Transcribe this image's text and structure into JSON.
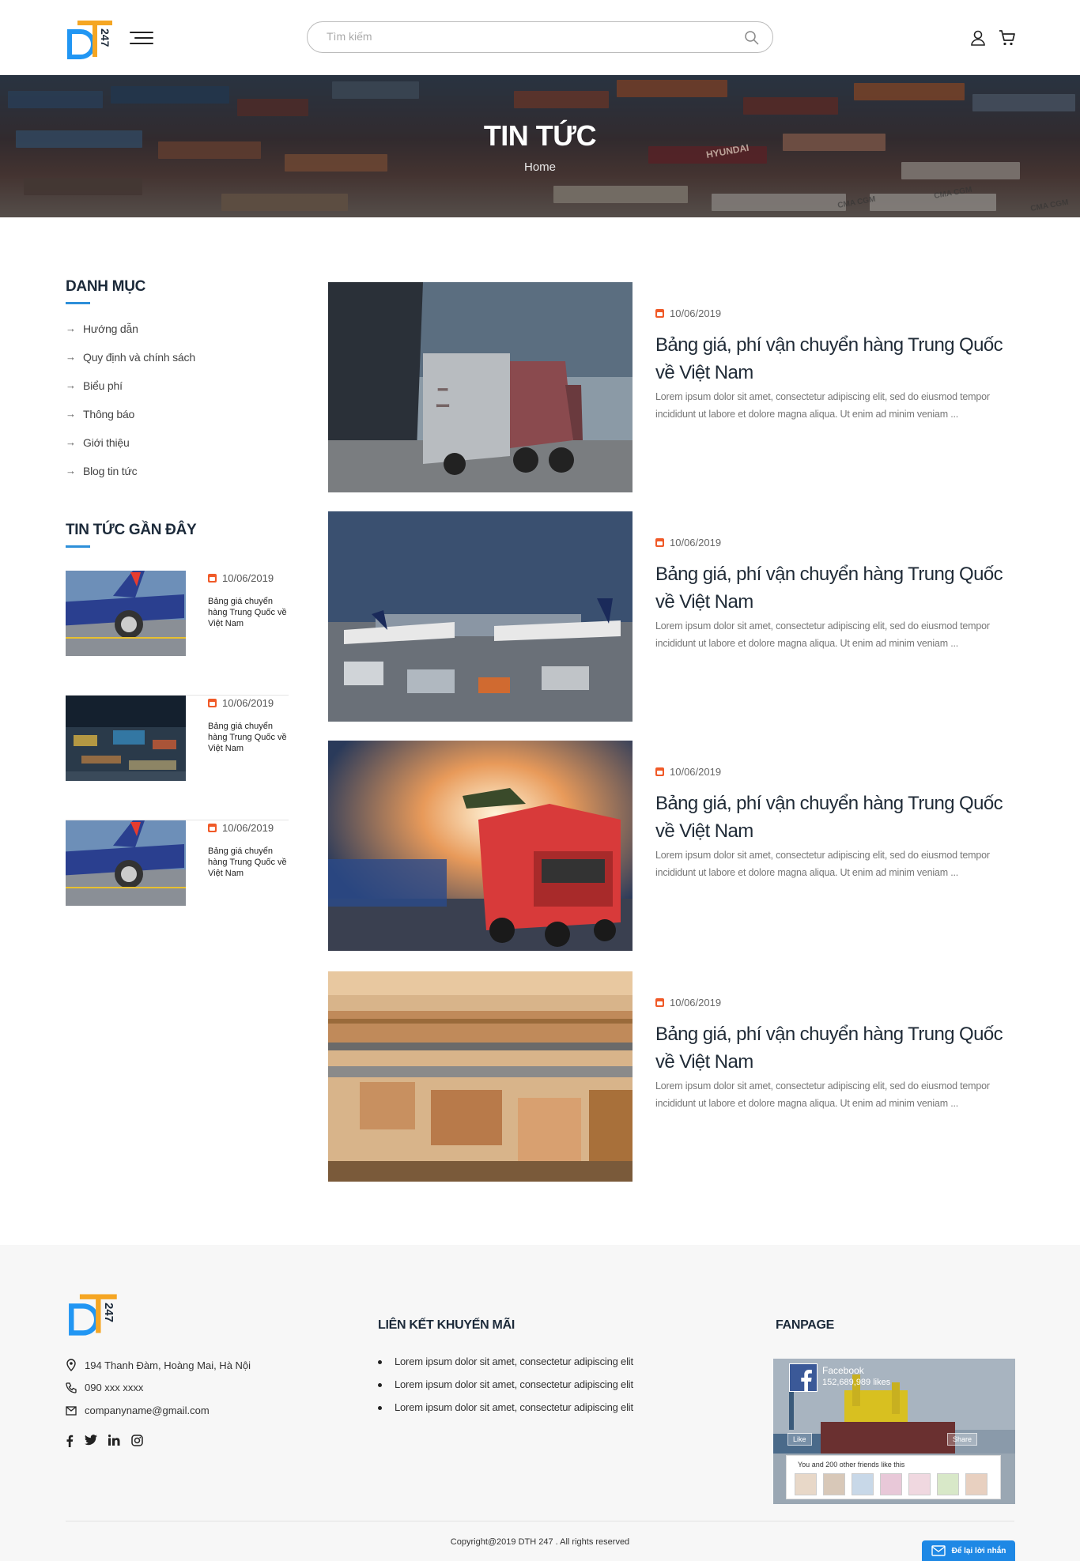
{
  "header": {
    "search_placeholder": "Tìm kiếm",
    "logo_text": "247"
  },
  "banner": {
    "title": "TIN TỨC",
    "breadcrumb": "Home",
    "container_texts": [
      "HYUNDAI",
      "CMA CGM",
      "CMA CGM",
      "CMA CGM"
    ]
  },
  "sidebar": {
    "categories_title": "DANH MỤC",
    "categories": [
      {
        "label": "Hướng dẫn"
      },
      {
        "label": "Quy định và chính sách"
      },
      {
        "label": "Biểu phí"
      },
      {
        "label": "Thông báo"
      },
      {
        "label": "Giới thiệu"
      },
      {
        "label": "Blog tin tức"
      }
    ],
    "recent_title": "TIN TỨC GẦN ĐÂY",
    "recent": [
      {
        "date": "10/06/2019",
        "title": "Bảng giá chuyển hàng Trung Quốc về Việt Nam",
        "image": "airplane"
      },
      {
        "date": "10/06/2019",
        "title": "Bảng giá chuyển hàng Trung Quốc về Việt Nam",
        "image": "port-night"
      },
      {
        "date": "10/06/2019",
        "title": "Bảng giá chuyển hàng Trung Quốc về Việt Nam",
        "image": "airplane"
      }
    ]
  },
  "posts": [
    {
      "date": "10/06/2019",
      "title": "Bảng giá, phí vận chuyển hàng Trung Quốc về Việt Nam",
      "excerpt": "Lorem ipsum dolor sit amet, consectetur adipiscing elit, sed do eiusmod tempor incididunt ut labore et dolore magna aliqua. Ut enim ad minim veniam ...",
      "image": "truck"
    },
    {
      "date": "10/06/2019",
      "title": "Bảng giá, phí vận chuyển hàng Trung Quốc về Việt Nam",
      "excerpt": "Lorem ipsum dolor sit amet, consectetur adipiscing elit, sed do eiusmod tempor incididunt ut labore et dolore magna aliqua. Ut enim ad minim veniam ...",
      "image": "airport"
    },
    {
      "date": "10/06/2019",
      "title": "Bảng giá, phí vận chuyển hàng Trung Quốc về Việt Nam",
      "excerpt": "Lorem ipsum dolor sit amet, consectetur adipiscing elit, sed do eiusmod tempor incididunt ut labore et dolore magna aliqua. Ut enim ad minim veniam ...",
      "image": "red-truck"
    },
    {
      "date": "10/06/2019",
      "title": "Bảng giá, phí vận chuyển hàng Trung Quốc về Việt Nam",
      "excerpt": "Lorem ipsum dolor sit amet, consectetur adipiscing elit, sed do eiusmod tempor incididunt ut labore et dolore magna aliqua. Ut enim ad minim veniam ...",
      "image": "warehouse"
    }
  ],
  "footer": {
    "address": "194 Thanh Đàm, Hoàng Mai, Hà Nội",
    "phone": "090 xxx xxxx",
    "email": "companyname@gmail.com",
    "social": [
      "facebook-icon",
      "twitter-icon",
      "linkedin-icon",
      "instagram-icon"
    ],
    "links_title": "LIÊN KẾT KHUYẾN MÃI",
    "links": [
      "Lorem ipsum dolor sit amet, consectetur adipiscing elit",
      "Lorem ipsum dolor sit amet, consectetur adipiscing elit",
      "Lorem ipsum dolor sit amet, consectetur adipiscing elit"
    ],
    "fanpage_title": "FANPAGE",
    "fanpage": {
      "name": "Facebook",
      "likes": "152,689,989 likes",
      "like_btn": "Like",
      "share_btn": "Share",
      "friends_text": "You and 200 other friends like this"
    },
    "copyright": "Copyright@2019 DTH 247 . All rights reserved",
    "chat_label": "Để lại lời nhắn"
  },
  "colors": {
    "accent_blue": "#2d8fd9",
    "date_orange": "#f05a28",
    "logo_orange": "#f5a623",
    "logo_blue": "#2196f3"
  }
}
